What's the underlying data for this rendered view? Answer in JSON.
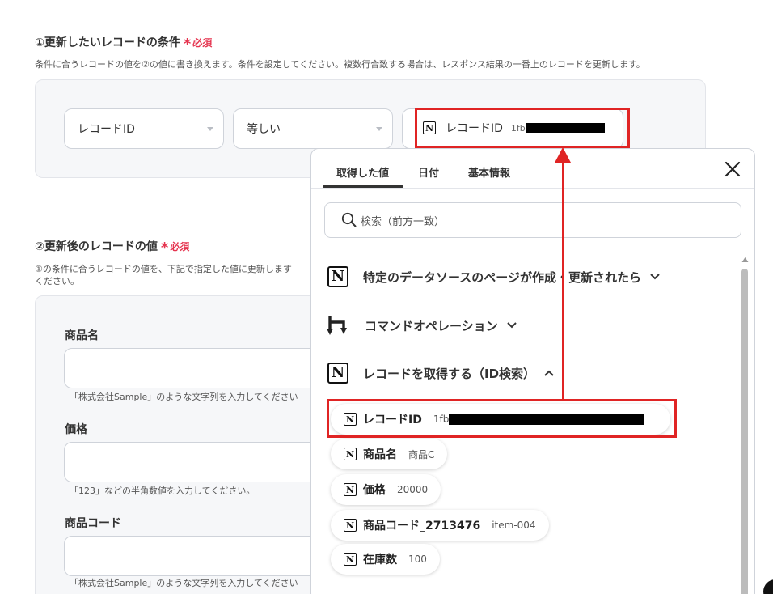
{
  "section1": {
    "title": "①更新したいレコードの条件",
    "required": "必須",
    "hint": "条件に合うレコードの値を②の値に書き換えます。条件を設定してください。複数行合致する場合は、レスポンス結果の一番上のレコードを更新します。",
    "field_select": "レコードID",
    "operator_select": "等しい",
    "value_chip": {
      "label": "レコードID",
      "prefix": "1fb"
    }
  },
  "section2": {
    "title": "②更新後のレコードの値",
    "required": "必須",
    "hint_line1": "①の条件に合うレコードの値を、下記で指定した値に更新します",
    "hint_line2": "ください。",
    "fields": [
      {
        "label": "商品名",
        "hint": "「株式会社Sample」のような文字列を入力してください"
      },
      {
        "label": "価格",
        "hint": "「123」などの半角数値を入力してください。"
      },
      {
        "label": "商品コード",
        "hint": "「株式会社Sample」のような文字列を入力してください"
      }
    ]
  },
  "popup": {
    "tabs": [
      "取得した値",
      "日付",
      "基本情報"
    ],
    "active_tab": "取得した値",
    "search_placeholder": "検索（前方一致）",
    "groups": [
      {
        "label": "特定のデータソースのページが作成・更新されたら",
        "icon": "notion-icon",
        "expanded": false
      },
      {
        "label": "コマンドオペレーション",
        "icon": "command-operation-icon",
        "expanded": false
      },
      {
        "label": "レコードを取得する（ID検索）",
        "icon": "notion-icon",
        "expanded": true
      }
    ],
    "items": [
      {
        "name": "レコードID",
        "value": "1fb"
      },
      {
        "name": "商品名",
        "value": "商品C"
      },
      {
        "name": "価格",
        "value": "20000"
      },
      {
        "name": "商品コード_2713476",
        "value": "item-004"
      },
      {
        "name": "在庫数",
        "value": "100"
      }
    ]
  },
  "colors": {
    "accent_red": "#e02424",
    "required_pink": "#e5344f",
    "panel_bg": "#f6f7f9"
  }
}
